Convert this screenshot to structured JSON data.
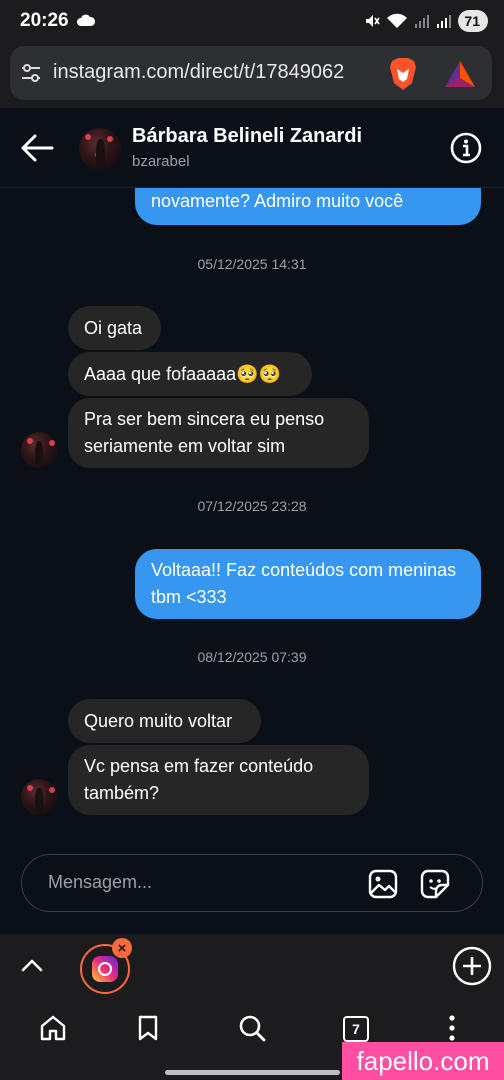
{
  "status": {
    "time": "20:26",
    "battery": "71"
  },
  "browser": {
    "url": "instagram.com/direct/t/17849062",
    "tab_count": "7"
  },
  "chat": {
    "contact_name": "Bárbara Belineli Zanardi",
    "username": "bzarabel"
  },
  "messages": [
    {
      "type": "sent",
      "text": "novamente? Admiro muito você"
    },
    {
      "type": "time",
      "text": "05/12/2025 14:31"
    },
    {
      "type": "recv",
      "text": "Oi gata"
    },
    {
      "type": "recv",
      "text": "Aaaa que fofaaaaa🥺🥺"
    },
    {
      "type": "recv",
      "text": "Pra ser bem sincera eu penso seriamente em voltar sim"
    },
    {
      "type": "time",
      "text": "07/12/2025 23:28"
    },
    {
      "type": "sent",
      "text": "Voltaaa!! Faz conteúdos com meninas tbm <333"
    },
    {
      "type": "time",
      "text": "08/12/2025 07:39"
    },
    {
      "type": "recv",
      "text": "Quero muito voltar"
    },
    {
      "type": "recv",
      "text": "Vc pensa em fazer conteúdo também?"
    }
  ],
  "composer": {
    "placeholder": "Mensagem..."
  },
  "watermark": "fapello.com",
  "colors": {
    "sent_bubble": "#3797f0",
    "received_bubble": "#262626",
    "background": "#0b0f17",
    "tab_accent": "#ff6a3d"
  }
}
